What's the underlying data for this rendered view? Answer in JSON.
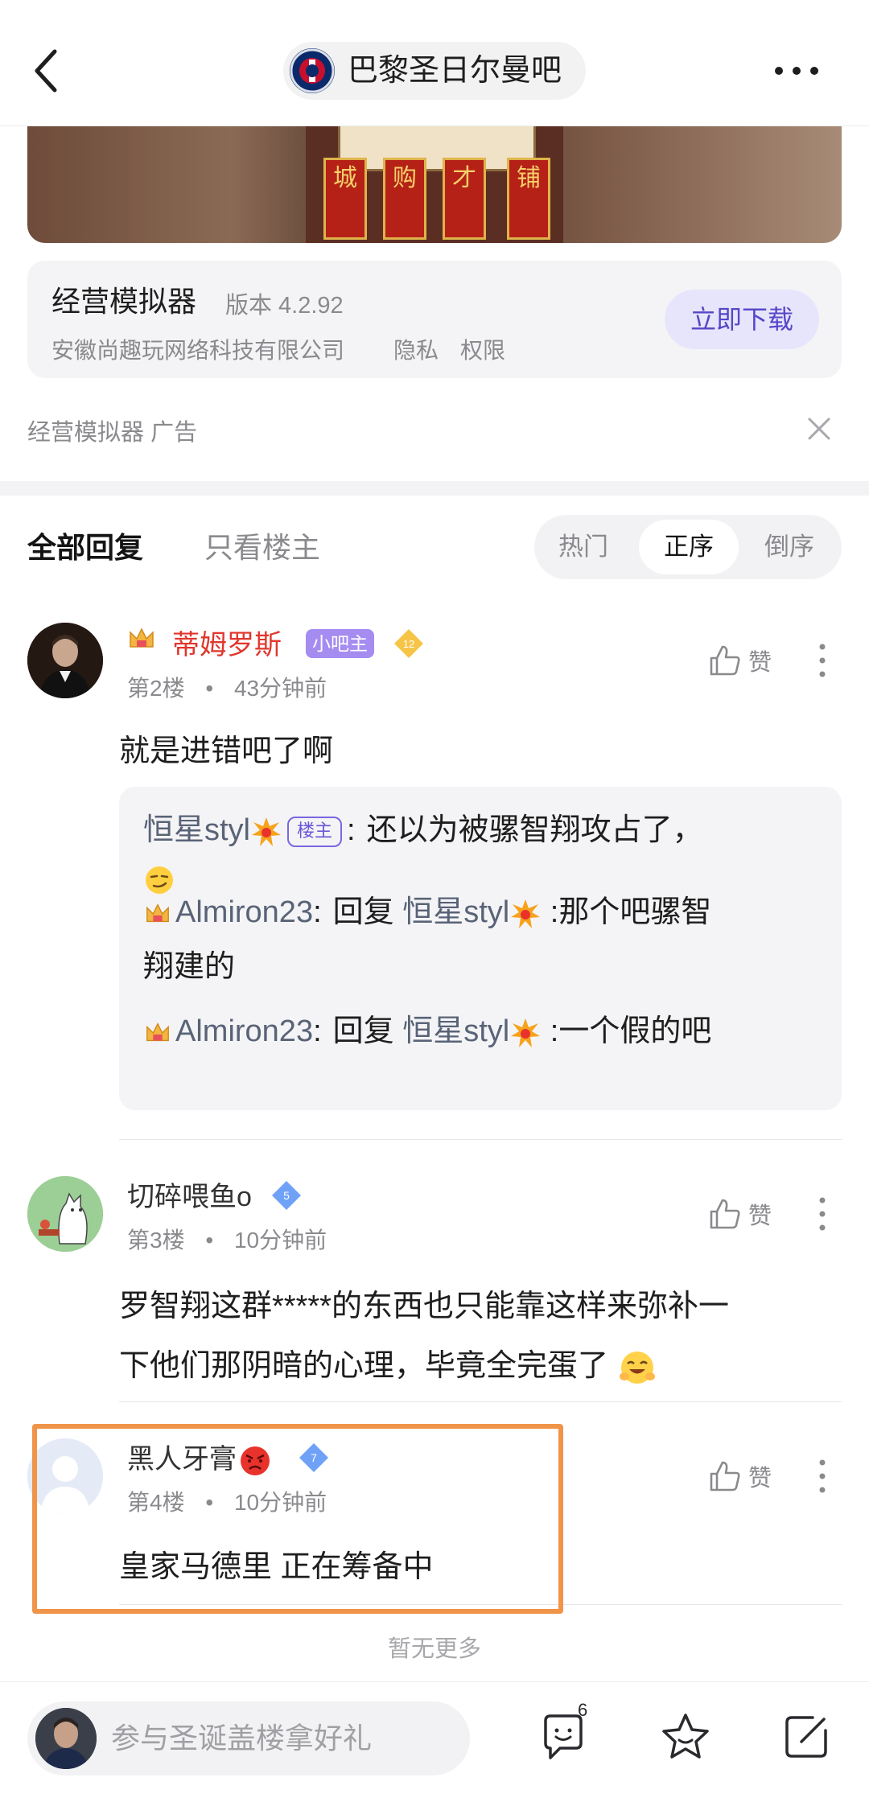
{
  "header": {
    "forum_name": "巴黎圣日尔曼吧"
  },
  "ad": {
    "sign_chars": [
      "城",
      "购",
      "才",
      "铺"
    ],
    "app_name": "经营模拟器",
    "version": "版本 4.2.92",
    "company": "安徽尚趣玩网络科技有限公司",
    "privacy": "隐私",
    "permission": "权限",
    "download_label": "立即下载",
    "source": "经营模拟器",
    "ad_label": "广告"
  },
  "tabs": {
    "all": "全部回复",
    "op_only": "只看楼主"
  },
  "sort": {
    "hot": "热门",
    "asc": "正序",
    "desc": "倒序"
  },
  "posts": [
    {
      "username": "蒂姆罗斯",
      "role_tag": "小吧主",
      "level": "12",
      "floor": "第2楼",
      "dot": "•",
      "time": "43分钟前",
      "like_label": "赞",
      "content": "就是进错吧了啊",
      "replies": [
        {
          "name": "恒星styl",
          "tag": "楼主",
          "sep": ":",
          "text": "还以为被骡智翔攻占了，"
        },
        {
          "name": "Almiron23",
          "sep": ":",
          "prefix": "回复 ",
          "target": "恒星styl",
          "text": " :那个吧骡智",
          "text_cont": "翔建的"
        },
        {
          "name": "Almiron23",
          "sep": ":",
          "prefix": "回复 ",
          "target": "恒星styl",
          "text": " :一个假的吧"
        }
      ]
    },
    {
      "username": "切碎喂鱼o",
      "level": "5",
      "floor": "第3楼",
      "dot": "•",
      "time": "10分钟前",
      "like_label": "赞",
      "content_line1": "罗智翔这群*****的东西也只能靠这样来弥补一",
      "content_line2": "下他们那阴暗的心理，毕竟全完蛋了"
    },
    {
      "username": "黑人牙膏",
      "level": "7",
      "floor": "第4楼",
      "dot": "•",
      "time": "10分钟前",
      "like_label": "赞",
      "content": "皇家马德里 正在筹备中"
    }
  ],
  "footer": {
    "no_more": "暂无更多",
    "comment_placeholder": "参与圣诞盖楼拿好礼",
    "comment_count": "6"
  },
  "colors": {
    "accent": "#5646c8",
    "moderator_name": "#e0362c",
    "highlight_border": "#f0944a",
    "diamond": "#5b8ff9"
  }
}
